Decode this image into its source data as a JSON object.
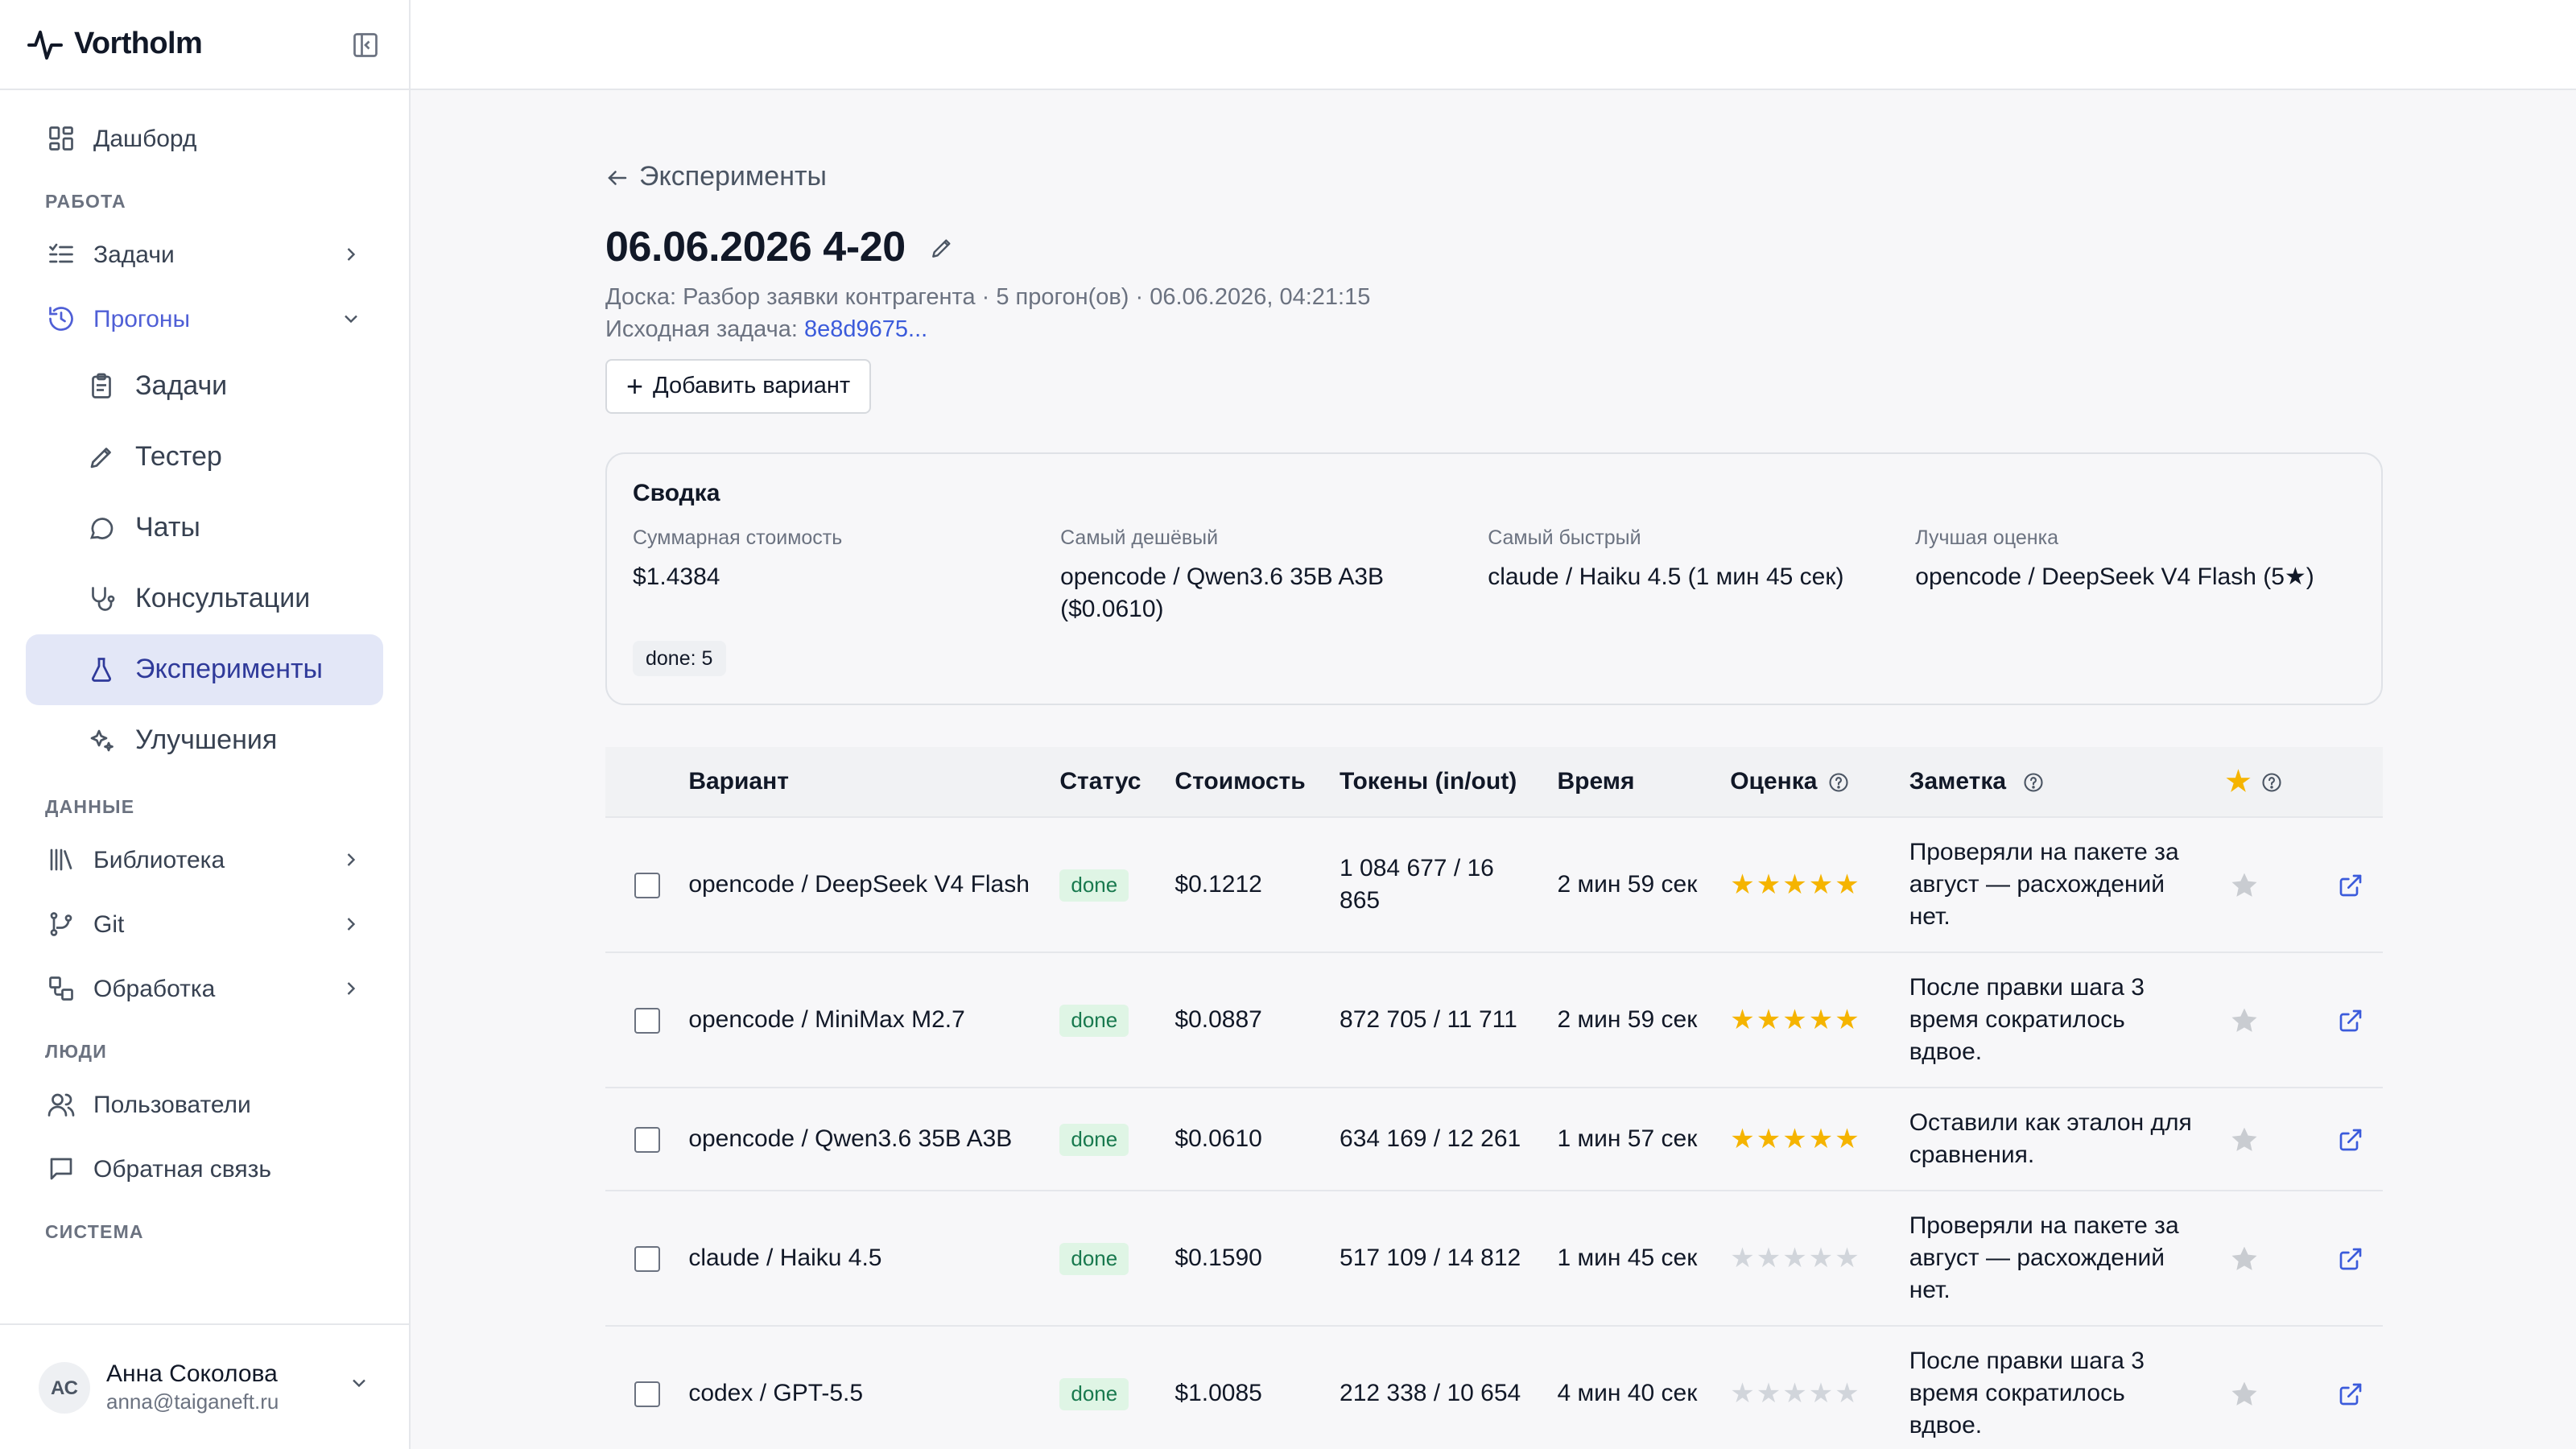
{
  "brand": {
    "name": "Vortholm"
  },
  "sidebar": {
    "dashboard": "Дашборд",
    "sections": {
      "work": "РАБОТА",
      "data": "ДАННЫЕ",
      "people": "ЛЮДИ",
      "system": "СИСТЕМА"
    },
    "tasks": "Задачи",
    "runs": "Прогоны",
    "runs_children": [
      "Задачи",
      "Тестер",
      "Чаты",
      "Консультации",
      "Эксперименты",
      "Улучшения"
    ],
    "library": "Библиотека",
    "git": "Git",
    "processing": "Обработка",
    "users": "Пользователи",
    "feedback": "Обратная связь",
    "user": {
      "initials": "АС",
      "name": "Анна Соколова",
      "email": "anna@taiganeft.ru"
    }
  },
  "page": {
    "back_label": "Эксперименты",
    "title": "06.06.2026 4-20",
    "meta_line": "Доска: Разбор заявки контрагента · 5 прогон(ов) · 06.06.2026, 04:21:15",
    "source_label": "Исходная задача:",
    "source_link": "8e8d9675...",
    "add_variant": "Добавить вариант"
  },
  "summary": {
    "title": "Сводка",
    "items": [
      {
        "label": "Суммарная стоимость",
        "value": "$1.4384"
      },
      {
        "label": "Самый дешёвый",
        "value": "opencode / Qwen3.6 35B A3B ($0.0610)"
      },
      {
        "label": "Самый быстрый",
        "value": "claude / Haiku 4.5 (1 мин 45 сек)"
      },
      {
        "label": "Лучшая оценка",
        "value": "opencode / DeepSeek V4 Flash (5★)"
      }
    ],
    "status_pill": "done: 5"
  },
  "table": {
    "headers": {
      "variant": "Вариант",
      "status": "Статус",
      "cost": "Стоимость",
      "tokens": "Токены (in/out)",
      "time": "Время",
      "rating": "Оценка",
      "note": "Заметка"
    },
    "rows": [
      {
        "variant": "opencode / DeepSeek V4 Flash",
        "status": "done",
        "cost": "$0.1212",
        "tokens": "1 084 677 / 16 865",
        "time": "2 мин 59 сек",
        "rating": 5,
        "note": "Проверяли на пакете за август — расхождений нет."
      },
      {
        "variant": "opencode / MiniMax M2.7",
        "status": "done",
        "cost": "$0.0887",
        "tokens": "872 705 / 11 711",
        "time": "2 мин 59 сек",
        "rating": 5,
        "note": "После правки шага 3 время сократилось вдвое."
      },
      {
        "variant": "opencode / Qwen3.6 35B A3B",
        "status": "done",
        "cost": "$0.0610",
        "tokens": "634 169 / 12 261",
        "time": "1 мин 57 сек",
        "rating": 5,
        "note": "Оставили как эталон для сравнения."
      },
      {
        "variant": "claude / Haiku 4.5",
        "status": "done",
        "cost": "$0.1590",
        "tokens": "517 109 / 14 812",
        "time": "1 мин 45 сек",
        "rating": 0,
        "note": "Проверяли на пакете за август — расхождений нет."
      },
      {
        "variant": "codex / GPT-5.5",
        "status": "done",
        "cost": "$1.0085",
        "tokens": "212 338 / 10 654",
        "time": "4 мин 40 сек",
        "rating": 0,
        "note": "После правки шага 3 время сократилось вдвое."
      }
    ]
  },
  "colors": {
    "accent": "#4f5fd6",
    "star_on": "#f5b400",
    "star_off": "#d1d5db",
    "badge_bg": "#dff5e5",
    "badge_fg": "#18794e",
    "link": "#3b5bdb"
  }
}
